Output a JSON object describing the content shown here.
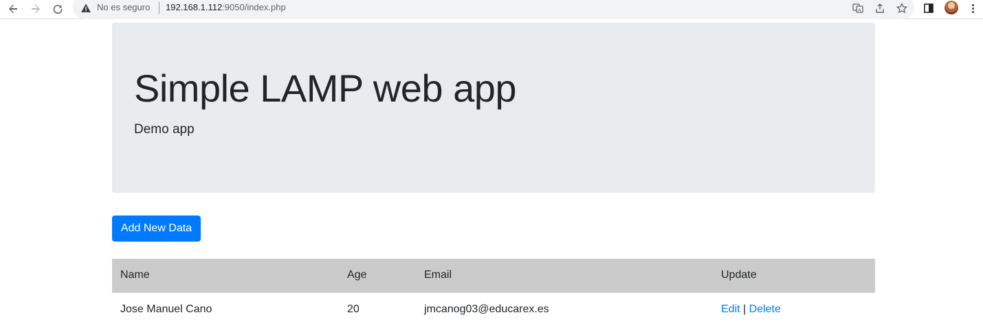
{
  "browser": {
    "security_text": "No es seguro",
    "url_host": "192.168.1.112",
    "url_rest": ":9050/index.php"
  },
  "jumbotron": {
    "title": "Simple LAMP web app",
    "subtitle": "Demo app"
  },
  "actions": {
    "add_label": "Add New Data"
  },
  "table": {
    "headers": {
      "name": "Name",
      "age": "Age",
      "email": "Email",
      "update": "Update"
    },
    "rows": [
      {
        "name": "Jose Manuel Cano",
        "age": "20",
        "email": "jmcanog03@educarex.es",
        "edit": "Edit",
        "separator": "|",
        "delete": "Delete"
      }
    ]
  },
  "colors": {
    "jumbotron_bg": "#e9ecef",
    "primary": "#007bff",
    "table_header_bg": "#cbcbcb"
  }
}
